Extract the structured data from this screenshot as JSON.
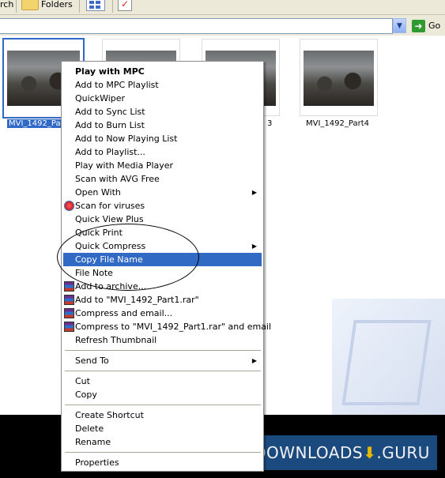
{
  "toolbar": {
    "search_label": "rch",
    "folders_label": "Folders"
  },
  "address": {
    "value": "",
    "go_label": "Go"
  },
  "files": [
    {
      "name": "MVI_1492_Pa"
    },
    {
      "name": ""
    },
    {
      "name": "3"
    },
    {
      "name": "MVI_1492_Part4"
    }
  ],
  "context_menu": {
    "items": [
      {
        "label": "Play with MPC",
        "bold": true
      },
      {
        "label": "Add to MPC Playlist"
      },
      {
        "label": "QuickWiper"
      },
      {
        "label": "Add to Sync List"
      },
      {
        "label": "Add to Burn List"
      },
      {
        "label": "Add to Now Playing List"
      },
      {
        "label": "Add to Playlist..."
      },
      {
        "label": "Play with Media Player"
      },
      {
        "label": "Scan with AVG Free"
      },
      {
        "label": "Open With"
      },
      {
        "label": "Scan for viruses"
      },
      {
        "label": "Quick View Plus"
      },
      {
        "label": "Quick Print"
      },
      {
        "label": "Quick Compress"
      },
      {
        "label": "Copy File Name"
      },
      {
        "label": "File Note"
      },
      {
        "label": "Add to archive..."
      },
      {
        "label": "Add to \"MVI_1492_Part1.rar\""
      },
      {
        "label": "Compress and email..."
      },
      {
        "label": "Compress to \"MVI_1492_Part1.rar\" and email"
      },
      {
        "label": "Refresh Thumbnail"
      },
      {
        "label": "Send To"
      },
      {
        "label": "Cut"
      },
      {
        "label": "Copy"
      },
      {
        "label": "Create Shortcut"
      },
      {
        "label": "Delete"
      },
      {
        "label": "Rename"
      },
      {
        "label": "Properties"
      }
    ]
  },
  "watermark": {
    "brand_left": "DOWNLOADS",
    "brand_right": ".GURU"
  },
  "colors": {
    "highlight": "#316ac5",
    "brand_bg": "#1d4f86",
    "toolbar_bg": "#ece9d8"
  }
}
